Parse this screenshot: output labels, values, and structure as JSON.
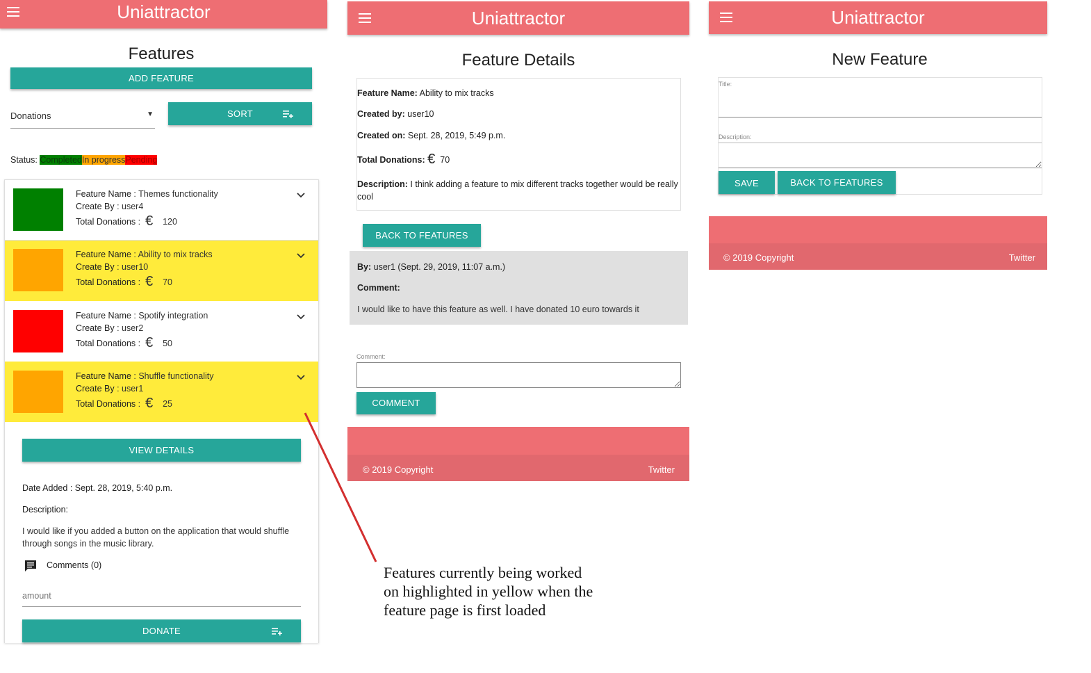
{
  "left": {
    "brand": "Uniattractor",
    "title": "Features",
    "add_button": "ADD FEATURE",
    "sort_select": "Donations",
    "sort_button": "SORT",
    "status_label": "Status:",
    "status_tags": [
      {
        "label": "Completed",
        "color": "#008000"
      },
      {
        "label": "In progress",
        "color": "#ffa500"
      },
      {
        "label": "Pending",
        "color": "#ff0000"
      }
    ],
    "features": [
      {
        "name_label": "Feature Name",
        "name": " : Themes functionality",
        "creator_label": "Create By",
        "creator": " : user4",
        "donations_label": "Total Donations",
        "donations": "120",
        "color": "#008000",
        "highlight": "#ffffff"
      },
      {
        "name_label": "Feature Name",
        "name": " : Ability to mix tracks",
        "creator_label": "Create By",
        "creator": " : user10",
        "donations_label": "Total Donations",
        "donations": "70",
        "color": "#ffa500",
        "highlight": "#ffeb3b"
      },
      {
        "name_label": "Feature Name",
        "name": " : Spotify integration",
        "creator_label": "Create By",
        "creator": " : user2",
        "donations_label": "Total Donations",
        "donations": "50",
        "color": "#ff0000",
        "highlight": "#ffffff"
      },
      {
        "name_label": "Feature Name",
        "name": " : Shuffle functionality",
        "creator_label": "Create By",
        "creator": " : user1",
        "donations_label": "Total Donations",
        "donations": "25",
        "color": "#ffa500",
        "highlight": "#ffeb3b"
      }
    ],
    "view_details_button": "VIEW DETAILS",
    "date_added_label": "Date Added",
    "date_added": " : Sept. 28, 2019, 5:40 p.m.",
    "description_label": "Description:",
    "description": "I would like if you added a button on the application that would shuffle through songs in the music library.",
    "comments_label": "Comments",
    "comments_count": " (0)",
    "amount_placeholder": "amount",
    "donate_button": "DONATE"
  },
  "middle": {
    "brand": "Uniattractor",
    "title": "Feature Details",
    "feature_name_label": "Feature Name:",
    "feature_name": " Ability to mix tracks",
    "created_by_label": "Created by:",
    "created_by": " user10",
    "created_on_label": "Created on:",
    "created_on": " Sept. 28, 2019, 5:49 p.m.",
    "total_donations_label": "Total Donations:",
    "total_donations": "70",
    "description_label": "Description:",
    "description": " I think adding a feature to mix different tracks together would be really cool",
    "back_button": "BACK TO FEATURES",
    "comment_by_label": "By:",
    "comment_by": " user1 (Sept. 29, 2019, 11:07 a.m.)",
    "comment_label": "Comment:",
    "comment_text": "I would like to have this feature as well. I have donated 10 euro towards it",
    "comment_field_label": "Comment:",
    "comment_button": "COMMENT",
    "footer_copyright": "© 2019 Copyright",
    "footer_link": "Twitter"
  },
  "right": {
    "brand": "Uniattractor",
    "title": "New Feature",
    "title_field_label": "Title:",
    "description_field_label": "Description:",
    "save_button": "SAVE",
    "back_button": "BACK TO FEATURES",
    "footer_copyright": "© 2019 Copyright",
    "footer_link": "Twitter"
  },
  "annotation": {
    "lines": [
      "Features currently being worked",
      "on highlighted in yellow when the",
      "feature page is first loaded"
    ],
    "arrow_color": "#d32f2f"
  },
  "icons": {
    "menu": "menu-icon",
    "expand": "chevron-down-icon",
    "euro": "euro-icon",
    "sort": "playlist-add-icon",
    "comment": "comment-icon"
  }
}
